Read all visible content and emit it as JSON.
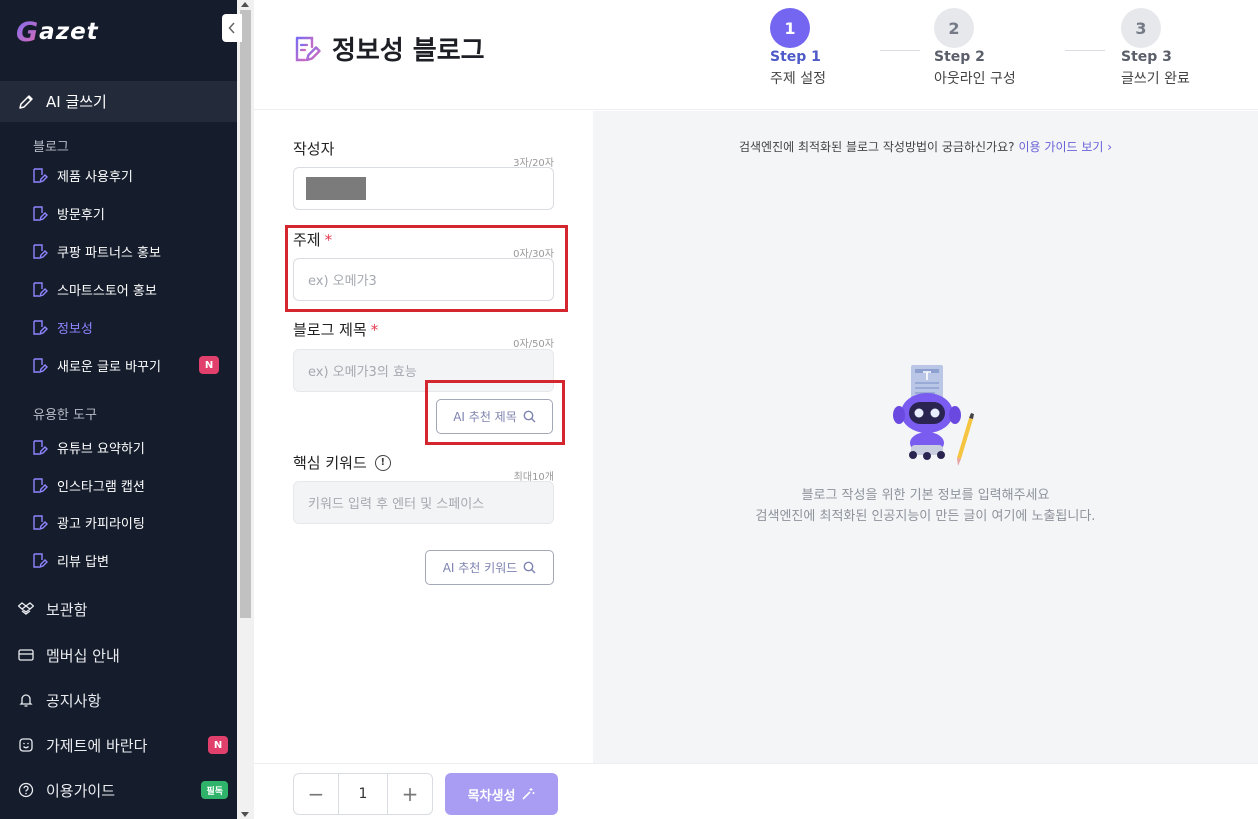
{
  "brand": {
    "logo_first": "G",
    "logo_rest": "azet"
  },
  "sidebar": {
    "ai_write": "AI 글쓰기",
    "blog_section": "블로그",
    "blog_items": [
      {
        "label": "제품 사용후기"
      },
      {
        "label": "방문후기"
      },
      {
        "label": "쿠팡 파트너스 홍보"
      },
      {
        "label": "스마트스토어 홍보"
      },
      {
        "label": "정보성",
        "active": true
      },
      {
        "label": "새로운 글로 바꾸기",
        "badge": "N"
      }
    ],
    "tools_section": "유용한 도구",
    "tool_items": [
      {
        "label": "유튜브 요약하기"
      },
      {
        "label": "인스타그램 캡션"
      },
      {
        "label": "광고 카피라이팅"
      },
      {
        "label": "리뷰 답변"
      }
    ],
    "main_items": [
      {
        "label": "보관함",
        "icon": "dropbox-icon"
      },
      {
        "label": "멤버십 안내",
        "icon": "card-icon"
      },
      {
        "label": "공지사항",
        "icon": "bell-icon"
      },
      {
        "label": "가제트에 바란다",
        "icon": "feedback-icon",
        "badge": "N"
      },
      {
        "label": "이용가이드",
        "icon": "help-icon",
        "badge": "필독"
      }
    ]
  },
  "header": {
    "title": "정보성 블로그",
    "steps": [
      {
        "num": "1",
        "name": "Step 1",
        "desc": "주제 설정",
        "active": true
      },
      {
        "num": "2",
        "name": "Step 2",
        "desc": "아웃라인 구성",
        "active": false
      },
      {
        "num": "3",
        "name": "Step 3",
        "desc": "글쓰기 완료",
        "active": false
      }
    ]
  },
  "form": {
    "author": {
      "label": "작성자",
      "counter": "3자/20자"
    },
    "topic": {
      "label": "주제",
      "required": "*",
      "counter": "0자/30자",
      "placeholder": "ex) 오메가3"
    },
    "blog_title": {
      "label": "블로그 제목",
      "required": "*",
      "counter": "0자/50자",
      "placeholder": "ex) 오메가3의 효능"
    },
    "ai_title_button": "AI 추천 제목",
    "keyword": {
      "label": "핵심 키워드",
      "info": "!",
      "counter": "최대10개",
      "placeholder": "키워드 입력 후 엔터 및 스페이스"
    },
    "ai_keyword_button": "AI 추천 키워드"
  },
  "panel": {
    "guide_text": "검색엔진에 최적화된 블로그 작성방법이 궁금하신가요?",
    "guide_link": "이용 가이드 보기 ›",
    "empty_line1": "블로그 작성을 위한 기본 정보를 입력해주세요",
    "empty_line2": "검색엔진에 최적화된 인공지능이 만든 글이 여기에 노출됩니다."
  },
  "footer": {
    "minus": "−",
    "count": "1",
    "plus": "+",
    "generate_button": "목차생성"
  },
  "colors": {
    "sidebar_bg": "#151c2c",
    "accent": "#7566f1",
    "highlight_red": "#d4262f",
    "badge_new": "#e0406b",
    "badge_must": "#2fb36b"
  }
}
